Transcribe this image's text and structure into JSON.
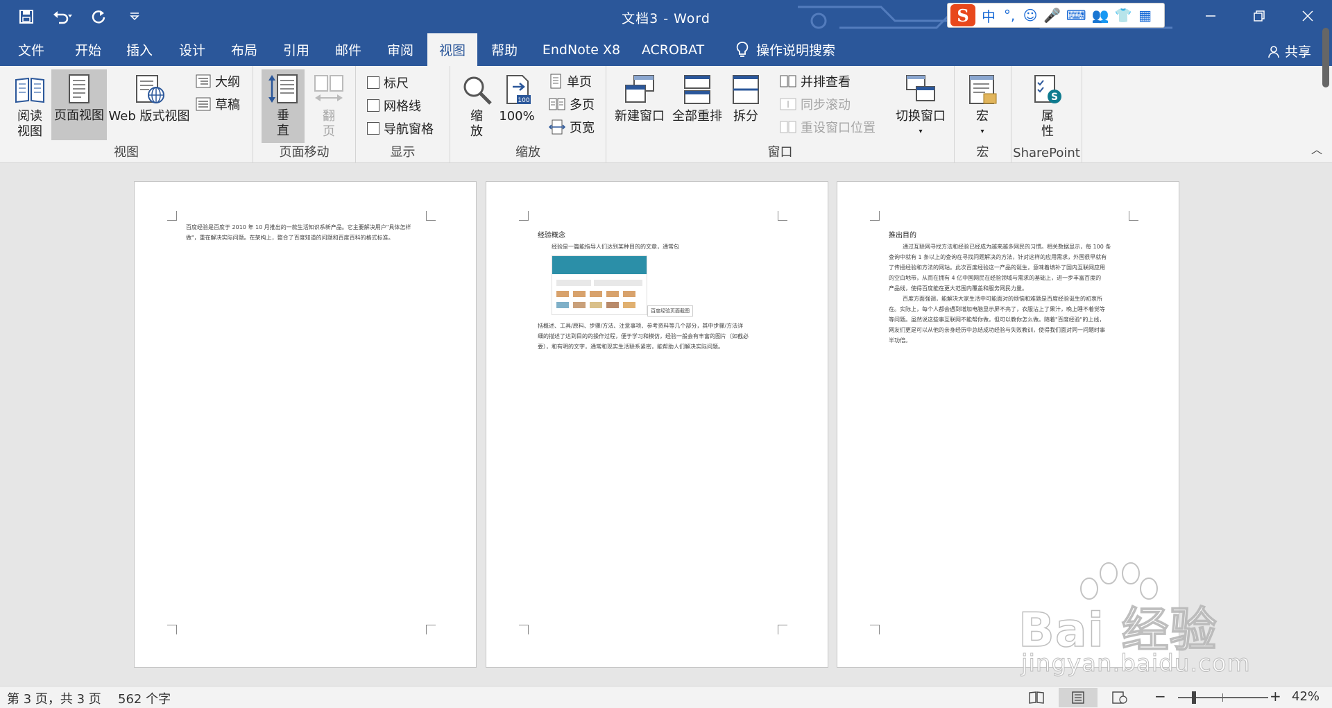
{
  "window": {
    "title": "文档3 - Word",
    "controls": [
      "minimize",
      "restore",
      "close"
    ]
  },
  "quick_access": {
    "icons": [
      "save-icon",
      "undo-icon",
      "redo-icon",
      "customize-icon"
    ]
  },
  "ime_toolbar": {
    "logo": "S",
    "items": [
      "中",
      "°,",
      "☺",
      "🎤",
      "⌨",
      "👥",
      "👕",
      "▦"
    ]
  },
  "tabs": [
    {
      "label": "文件",
      "active": false
    },
    {
      "label": "开始",
      "active": false
    },
    {
      "label": "插入",
      "active": false
    },
    {
      "label": "设计",
      "active": false
    },
    {
      "label": "布局",
      "active": false
    },
    {
      "label": "引用",
      "active": false
    },
    {
      "label": "邮件",
      "active": false
    },
    {
      "label": "审阅",
      "active": false
    },
    {
      "label": "视图",
      "active": true
    },
    {
      "label": "帮助",
      "active": false
    },
    {
      "label": "EndNote X8",
      "active": false
    },
    {
      "label": "ACROBAT",
      "active": false
    }
  ],
  "tell_me": "操作说明搜索",
  "share": "共享",
  "ribbon": {
    "views": {
      "label": "视图",
      "read_mode": [
        "阅读",
        "视图"
      ],
      "print_layout": "页面视图",
      "web_layout": "Web 版式视图",
      "outline": "大纲",
      "draft": "草稿"
    },
    "page_movement": {
      "label": "页面移动",
      "vertical": [
        "垂",
        "直"
      ],
      "side_to_side": [
        "翻",
        "页"
      ]
    },
    "show": {
      "label": "显示",
      "ruler": "标尺",
      "gridlines": "网格线",
      "nav_pane": "导航窗格",
      "ruler_checked": false,
      "gridlines_checked": false,
      "nav_pane_checked": false
    },
    "zoom": {
      "label": "缩放",
      "zoom": [
        "缩",
        "放"
      ],
      "hundred": "100%",
      "hundred_badge": "100",
      "one_page": "单页",
      "multiple_pages": "多页",
      "page_width": "页宽"
    },
    "window": {
      "label": "窗口",
      "new_window": "新建窗口",
      "arrange_all": "全部重排",
      "split": "拆分",
      "side_by_side": "并排查看",
      "sync_scroll": "同步滚动",
      "reset_position": "重设窗口位置",
      "switch_windows": "切换窗口"
    },
    "macros": {
      "label": "宏",
      "macros": "宏"
    },
    "sharepoint": {
      "label": "SharePoint",
      "properties": [
        "属",
        "性"
      ]
    }
  },
  "pages": [
    {
      "lines": [
        "百度经验是百度于 2010 年 10 月推出的一款生活知识系新产品。它主要解决用户\"具体怎样",
        "做\"，重在解决实际问题。在架构上，整合了百度知道的问题和百度百科的格式标准。"
      ]
    },
    {
      "heading": "经验概念",
      "intro": "经验是一篇能指导人们达到某种目的的文章，通常包",
      "caption": "百度经验页面截图",
      "lines": [
        "括概述、工具/原料、步骤/方法、注意事项、参考资料等几个部分，其中步骤/方法详",
        "细的描述了达到目的的操作过程，便于学习和模仿，经验一般会有丰富的图片（如截必",
        "要），和有明的文字，通常和现实生活联系紧密，能帮助人们解决实际问题。"
      ]
    },
    {
      "heading": "推出目的",
      "lines": [
        "通过互联网寻找方法和经验已经成为越来越多网民的习惯。相关数据显示，每 100 条",
        "查询中就有 1 条以上的查询在寻找问题解决的方法，针对这样的应用需求，外国很早就有",
        "了传授经验和方法的网站。此次百度经验这一产品的诞生，意味着填补了国内互联网应用",
        "的空白地带，从而在拥有 4 亿中国网民在经验领域与需求的基础上，进一步丰富百度的",
        "产品线，使得百度能在更大范围内覆盖和服务网民力量。",
        "百度方面强调，能解决大家生活中可能面对的烦恼和难题是百度经验诞生的初衷所",
        "在。实际上，每个人都会遇到增加电脑显示屏不亮了，衣服沾上了果汁，晚上睡不着觉等",
        "等问题。虽然说这些事互联网不能帮你做，但可以教你怎么做。随着\"百度经验\"的上线，",
        "网友们更是可以从他的亲身经历中总结成功经验与失败教训，使得我们面对同一问题时事",
        "半功倍。"
      ]
    }
  ],
  "status": {
    "page": "第 3 页，共 3 页",
    "words": "562 个字",
    "zoom_percent": "42%",
    "zoom_minus": "−",
    "zoom_plus": "+",
    "zoom_level": 0.42,
    "view_icons": [
      "read-mode-icon",
      "print-layout-icon",
      "web-layout-icon"
    ]
  },
  "watermark": {
    "main": "Bai 经验",
    "sub": "jingyan.baidu.com"
  },
  "colors": {
    "brand": "#2b579a",
    "ribbon_bg": "#f3f3f3",
    "canvas": "#e6e6e6",
    "link": "#1f5ed6",
    "ime_logo": "#e8481c"
  }
}
